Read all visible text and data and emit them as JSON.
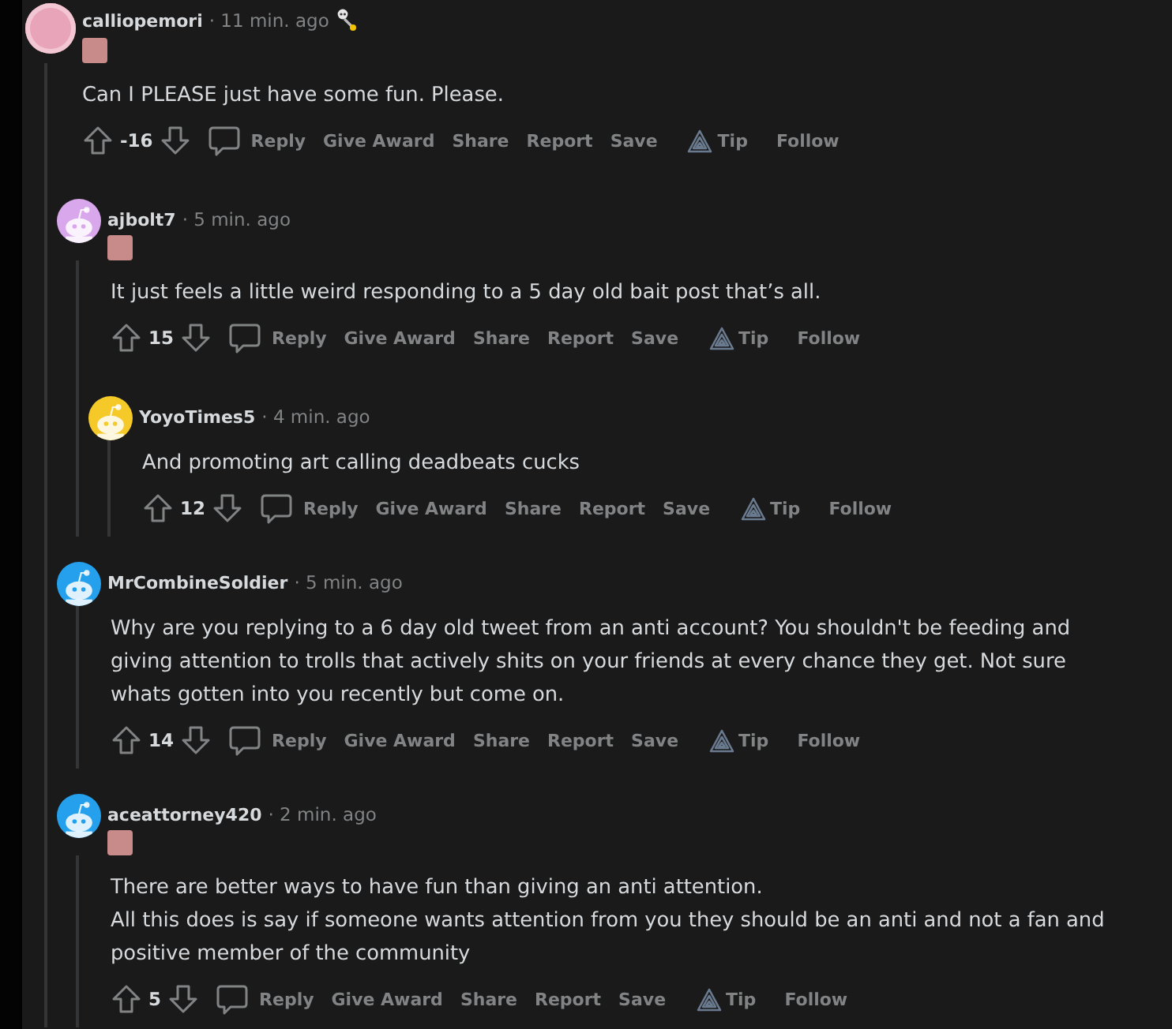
{
  "comments": [
    {
      "username": "calliopemori",
      "time": "· 11 min. ago",
      "avatar": {
        "kind": "photo",
        "color": "#e8a4b8"
      },
      "flair": true,
      "award": true,
      "body": [
        "Can I PLEASE just have some fun. Please."
      ],
      "score": "-16",
      "actions": [
        {
          "kind": "reply",
          "label": "Reply"
        },
        {
          "kind": "plain",
          "label": "Give Award"
        },
        {
          "kind": "plain",
          "label": "Share"
        },
        {
          "kind": "plain",
          "label": "Report"
        },
        {
          "kind": "plain",
          "label": "Save"
        },
        {
          "kind": "tip",
          "label": "Tip"
        },
        {
          "kind": "plain",
          "label": "Follow"
        }
      ],
      "children": [
        {
          "username": "ajbolt7",
          "time": "· 5 min. ago",
          "avatar": {
            "kind": "snoo",
            "color": "#d9a7ec"
          },
          "flair": true,
          "award": false,
          "body": [
            "It just feels a little weird responding to a 5 day old bait post that’s all."
          ],
          "score": "15",
          "actions": [
            {
              "kind": "reply",
              "label": "Reply"
            },
            {
              "kind": "plain",
              "label": "Give Award"
            },
            {
              "kind": "plain",
              "label": "Share"
            },
            {
              "kind": "plain",
              "label": "Report"
            },
            {
              "kind": "plain",
              "label": "Save"
            },
            {
              "kind": "tip",
              "label": "Tip"
            },
            {
              "kind": "plain",
              "label": "Follow"
            }
          ],
          "children": [
            {
              "username": "YoyoTimes5",
              "time": "· 4 min. ago",
              "avatar": {
                "kind": "snoo",
                "color": "#f5c928"
              },
              "flair": false,
              "award": false,
              "body": [
                "And promoting art calling deadbeats cucks"
              ],
              "score": "12",
              "actions": [
                {
                  "kind": "reply",
                  "label": "Reply"
                },
                {
                  "kind": "plain",
                  "label": "Give Award"
                },
                {
                  "kind": "plain",
                  "label": "Share"
                },
                {
                  "kind": "plain",
                  "label": "Report"
                },
                {
                  "kind": "plain",
                  "label": "Save"
                },
                {
                  "kind": "tip",
                  "label": "Tip"
                },
                {
                  "kind": "plain",
                  "label": "Follow"
                }
              ]
            }
          ]
        },
        {
          "username": "MrCombineSoldier",
          "time": "· 5 min. ago",
          "avatar": {
            "kind": "snoo",
            "color": "#24a0ed"
          },
          "flair": false,
          "award": false,
          "body": [
            "Why are you replying to a 6 day old tweet from an anti account? You shouldn't be feeding and giving attention to trolls that actively shits on your friends at every chance they get. Not sure whats gotten into you recently but come on."
          ],
          "score": "14",
          "actions": [
            {
              "kind": "reply",
              "label": "Reply"
            },
            {
              "kind": "plain",
              "label": "Give Award"
            },
            {
              "kind": "plain",
              "label": "Share"
            },
            {
              "kind": "plain",
              "label": "Report"
            },
            {
              "kind": "plain",
              "label": "Save"
            },
            {
              "kind": "tip",
              "label": "Tip"
            },
            {
              "kind": "plain",
              "label": "Follow"
            }
          ]
        },
        {
          "username": "aceattorney420",
          "time": "· 2 min. ago",
          "avatar": {
            "kind": "snoo",
            "color": "#24a0ed"
          },
          "flair": true,
          "award": false,
          "body": [
            "There are better ways to have fun than giving an anti attention.",
            "All this does is say if someone wants attention from you they should be an anti and not a fan and positive member of the community"
          ],
          "score": "5",
          "actions": [
            {
              "kind": "reply",
              "label": "Reply"
            },
            {
              "kind": "plain",
              "label": "Give Award"
            },
            {
              "kind": "plain",
              "label": "Share"
            },
            {
              "kind": "plain",
              "label": "Report"
            },
            {
              "kind": "plain",
              "label": "Save"
            },
            {
              "kind": "tip",
              "label": "Tip"
            },
            {
              "kind": "plain",
              "label": "Follow"
            }
          ]
        }
      ]
    }
  ]
}
